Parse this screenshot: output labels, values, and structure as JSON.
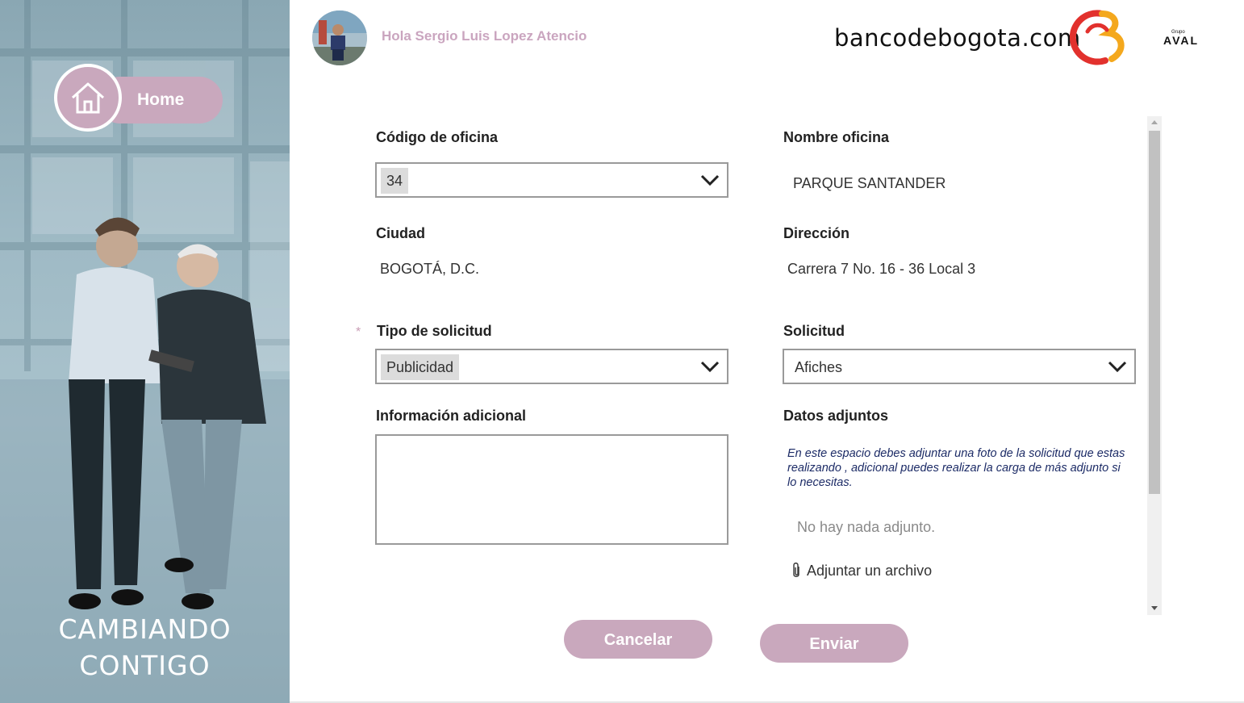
{
  "sidebar": {
    "home_label": "Home",
    "tagline_line1": "CAMBIANDO",
    "tagline_line2": "CONTIGO"
  },
  "header": {
    "greeting": "Hola Sergio Luis Lopez Atencio",
    "site": "bancodebogota.com",
    "group_small": "Grupo",
    "group_name": "AVAL"
  },
  "form": {
    "codigo_label": "Código de oficina",
    "codigo_value": "34",
    "nombre_label": "Nombre oficina",
    "nombre_value": "PARQUE SANTANDER",
    "ciudad_label": "Ciudad",
    "ciudad_value": "BOGOTÁ, D.C.",
    "direccion_label": "Dirección",
    "direccion_value": "Carrera 7 No. 16 - 36 Local 3",
    "required_mark": "*",
    "tipo_label": "Tipo de solicitud",
    "tipo_value": "Publicidad",
    "solicitud_label": "Solicitud",
    "solicitud_value": "Afiches",
    "info_label": "Información adicional",
    "info_value": "",
    "adjuntos_label": "Datos adjuntos",
    "adjuntos_help": "En este espacio debes adjuntar una foto de la solicitud que estas realizando , adicional puedes realizar la carga de más adjunto si lo necesitas.",
    "adjuntos_empty": "No hay nada adjunto.",
    "attach_label": "Adjuntar un archivo"
  },
  "buttons": {
    "cancel": "Cancelar",
    "send": "Enviar"
  },
  "colors": {
    "accent_pink": "#c9a8bd",
    "help_text": "#1c2b66",
    "hero_tint": "#9fbac5"
  },
  "icons": [
    "home-icon",
    "chevron-down-icon",
    "paperclip-icon",
    "bank-logo",
    "aval-logo"
  ]
}
